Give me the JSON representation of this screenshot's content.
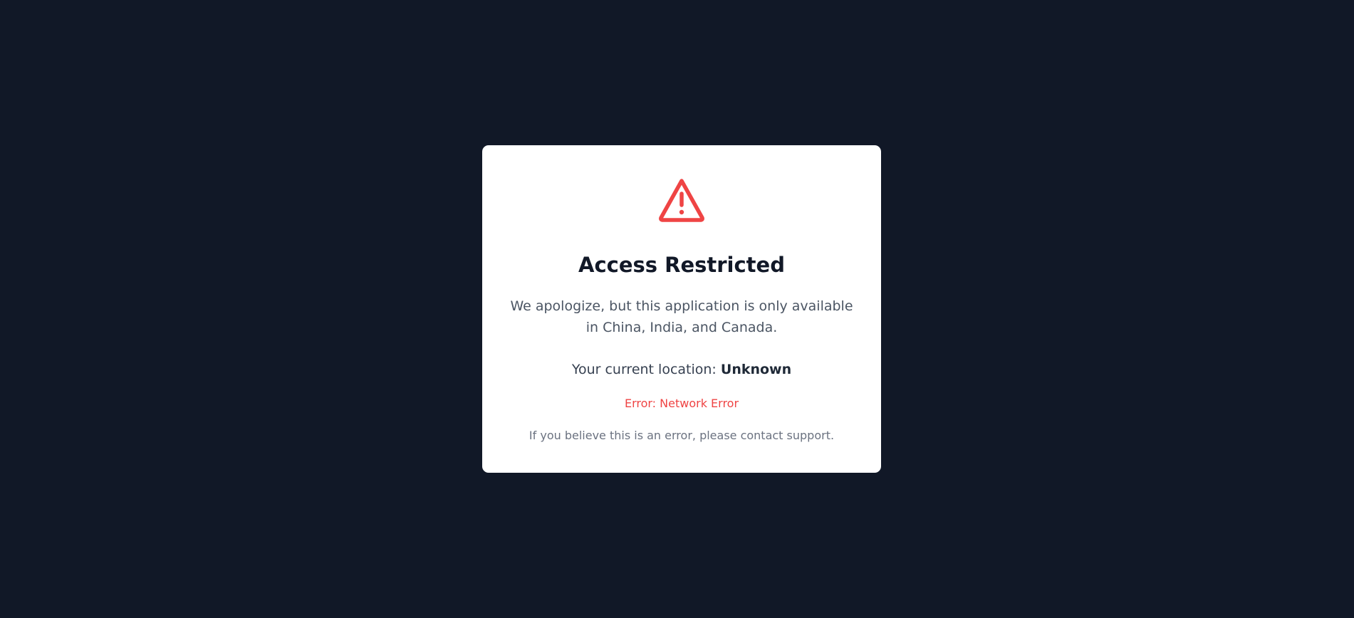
{
  "dialog": {
    "icon": "warning-triangle-icon",
    "title": "Access Restricted",
    "message": "We apologize, but this application is only available in China, India, and Canada.",
    "location_label": "Your current location:",
    "location_value": "Unknown",
    "error_text": "Error: Network Error",
    "support_text": "If you believe this is an error, please contact support."
  },
  "colors": {
    "background": "#111827",
    "card": "#ffffff",
    "accent_red": "#ef4444",
    "title": "#111827",
    "body_text": "#4b5563",
    "muted_text": "#6b7280"
  }
}
